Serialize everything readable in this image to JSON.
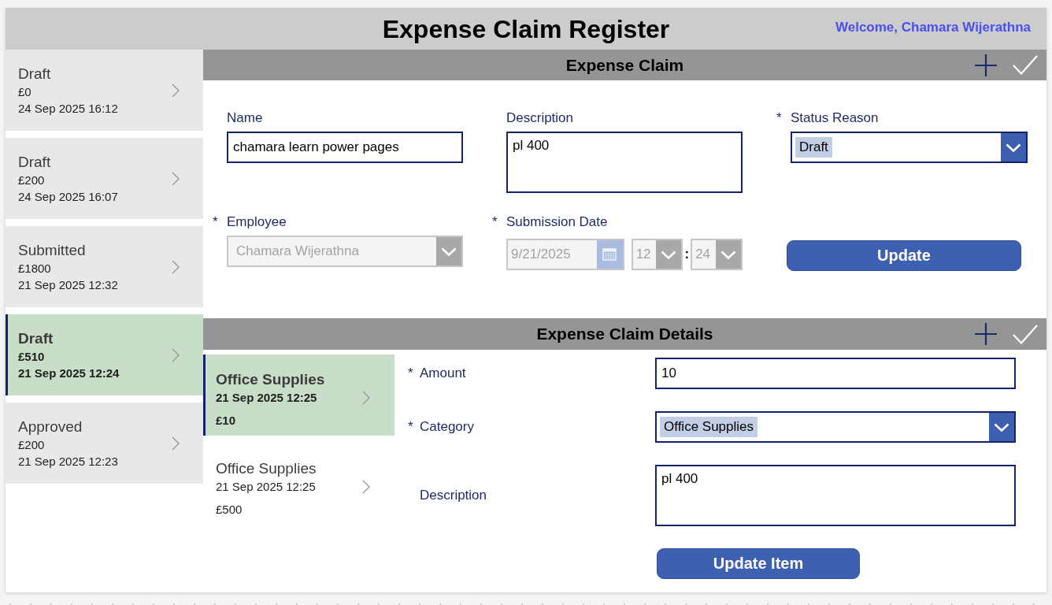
{
  "header": {
    "title": "Expense Claim Register",
    "welcome": "Welcome, Chamara Wijerathna"
  },
  "claims": [
    {
      "status": "Draft",
      "amount": "£0",
      "date": "24 Sep 2025 16:12",
      "selected": false
    },
    {
      "status": "Draft",
      "amount": "£200",
      "date": "24 Sep 2025 16:07",
      "selected": false
    },
    {
      "status": "Submitted",
      "amount": "£1800",
      "date": "21 Sep 2025 12:32",
      "selected": false
    },
    {
      "status": "Draft",
      "amount": "£510",
      "date": "21 Sep 2025 12:24",
      "selected": true
    },
    {
      "status": "Approved",
      "amount": "£200",
      "date": "21 Sep 2025 12:23",
      "selected": false
    }
  ],
  "claim_form": {
    "title": "Expense Claim",
    "fields": [
      {
        "kind": "text",
        "label": "Name",
        "value": "chamara learn power pages",
        "disabled": false
      },
      {
        "kind": "textarea",
        "label": "Description",
        "value": "pl 400",
        "disabled": false
      },
      {
        "kind": "dropdown",
        "label": "Status Reason",
        "required_mark": "*",
        "value": "Draft",
        "disabled": false
      },
      {
        "kind": "dropdown",
        "label": "Employee",
        "required_mark": "*",
        "value": "Chamara Wijerathna",
        "disabled": true
      },
      {
        "kind": "datetime",
        "label": "Submission Date",
        "required_mark": "*",
        "date": "9/21/2025",
        "hour": "12",
        "separator": ":",
        "minute": "24",
        "disabled": true
      }
    ],
    "button": "Update"
  },
  "details": {
    "title": "Expense Claim Details",
    "items": [
      {
        "category": "Office Supplies",
        "date": "21 Sep 2025 12:25",
        "amount": "£10",
        "selected": true
      },
      {
        "category": "Office Supplies",
        "date": "21 Sep 2025 12:25",
        "amount": "£500",
        "selected": false
      }
    ],
    "fields": [
      {
        "kind": "text",
        "label": "Amount",
        "required_mark": "*",
        "value": "10",
        "disabled": false
      },
      {
        "kind": "dropdown",
        "label": "Category",
        "required_mark": "*",
        "value": "Office Supplies",
        "disabled": false
      },
      {
        "kind": "textarea",
        "label": "Description",
        "value": "pl 400",
        "disabled": false
      }
    ],
    "button": "Update Item"
  }
}
